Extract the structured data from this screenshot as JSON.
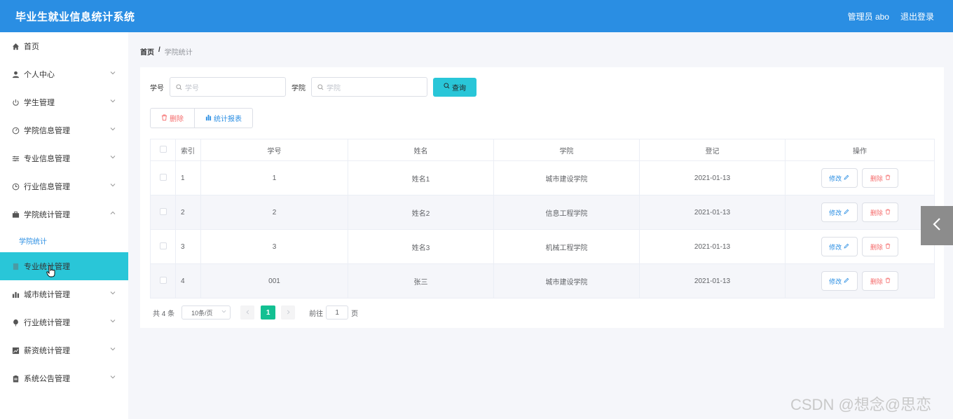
{
  "header": {
    "title": "毕业生就业信息统计系统",
    "user": "管理员 abo",
    "logout": "退出登录"
  },
  "sidebar": {
    "items": [
      {
        "label": "首页",
        "icon": "home-icon"
      },
      {
        "label": "个人中心",
        "icon": "user-icon"
      },
      {
        "label": "学生管理",
        "icon": "power-icon"
      },
      {
        "label": "学院信息管理",
        "icon": "gauge-icon"
      },
      {
        "label": "专业信息管理",
        "icon": "sliders-icon"
      },
      {
        "label": "行业信息管理",
        "icon": "clock-icon"
      },
      {
        "label": "学院统计管理",
        "icon": "briefcase-icon"
      },
      {
        "label": "学院统计"
      },
      {
        "label": "专业统计管理",
        "icon": "document-icon"
      },
      {
        "label": "城市统计管理",
        "icon": "bar-chart-icon"
      },
      {
        "label": "行业统计管理",
        "icon": "balloon-icon"
      },
      {
        "label": "薪资统计管理",
        "icon": "line-chart-icon"
      },
      {
        "label": "系统公告管理",
        "icon": "clipboard-icon"
      }
    ]
  },
  "breadcrumb": {
    "home": "首页",
    "sep": "/",
    "current": "学院统计"
  },
  "search": {
    "student_no_label": "学号",
    "student_no_placeholder": "学号",
    "college_label": "学院",
    "college_placeholder": "学院",
    "query_button": "查询"
  },
  "actions": {
    "delete": "删除",
    "report": "统计报表"
  },
  "table": {
    "columns": [
      "索引",
      "学号",
      "姓名",
      "学院",
      "登记",
      "操作"
    ],
    "rows": [
      {
        "index": "1",
        "no": "1",
        "name": "姓名1",
        "college": "城市建设学院",
        "date": "2021-01-13"
      },
      {
        "index": "2",
        "no": "2",
        "name": "姓名2",
        "college": "信息工程学院",
        "date": "2021-01-13"
      },
      {
        "index": "3",
        "no": "3",
        "name": "姓名3",
        "college": "机械工程学院",
        "date": "2021-01-13"
      },
      {
        "index": "4",
        "no": "001",
        "name": "张三",
        "college": "城市建设学院",
        "date": "2021-01-13"
      }
    ],
    "edit": "修改",
    "del": "删除"
  },
  "pagination": {
    "total": "共 4 条",
    "page_size": "10条/页",
    "current": "1",
    "goto_prefix": "前往",
    "goto_value": "1",
    "goto_suffix": "页"
  },
  "watermark": "CSDN @想念@思恋",
  "colors": {
    "header": "#2a8ee3",
    "accent": "#29c6d8",
    "page_active": "#13c092",
    "danger": "#f56c6c"
  }
}
